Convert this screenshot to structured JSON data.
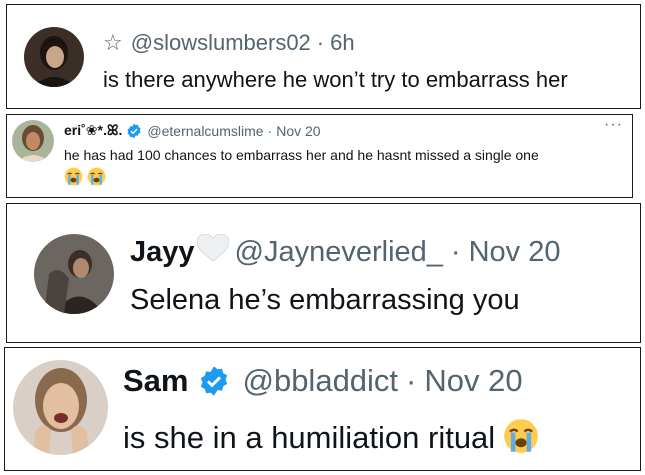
{
  "tweets": [
    {
      "display_name": "",
      "star_icon": "☆",
      "handle": "@slowslumbers02",
      "separator": "·",
      "time": "6h",
      "text": "is there anywhere he won’t try to embarrass her"
    },
    {
      "display_name": "eri˚❀*.ꕤ.",
      "verified": true,
      "handle": "@eternalcumslime",
      "separator": "·",
      "time": "Nov 20",
      "more": "···",
      "text": "he has had 100 chances to embarrass her and he hasnt missed a single one",
      "emojis": [
        "loudly-crying-face",
        "loudly-crying-face"
      ]
    },
    {
      "display_name": "Jayy",
      "heart_icon": "white-heart",
      "handle": "@Jayneverlied_",
      "separator": "·",
      "time": "Nov 20",
      "text": "Selena he’s embarrassing you"
    },
    {
      "display_name": "Sam",
      "verified": true,
      "handle": "@bbladdict",
      "separator": "·",
      "time": "Nov 20",
      "text": "is she in a humiliation ritual",
      "emojis": [
        "loudly-crying-face"
      ]
    }
  ],
  "colors": {
    "text": "#0f1419",
    "muted": "#536471",
    "verified": "#1d9bf0",
    "border": "#1a1a1a"
  }
}
